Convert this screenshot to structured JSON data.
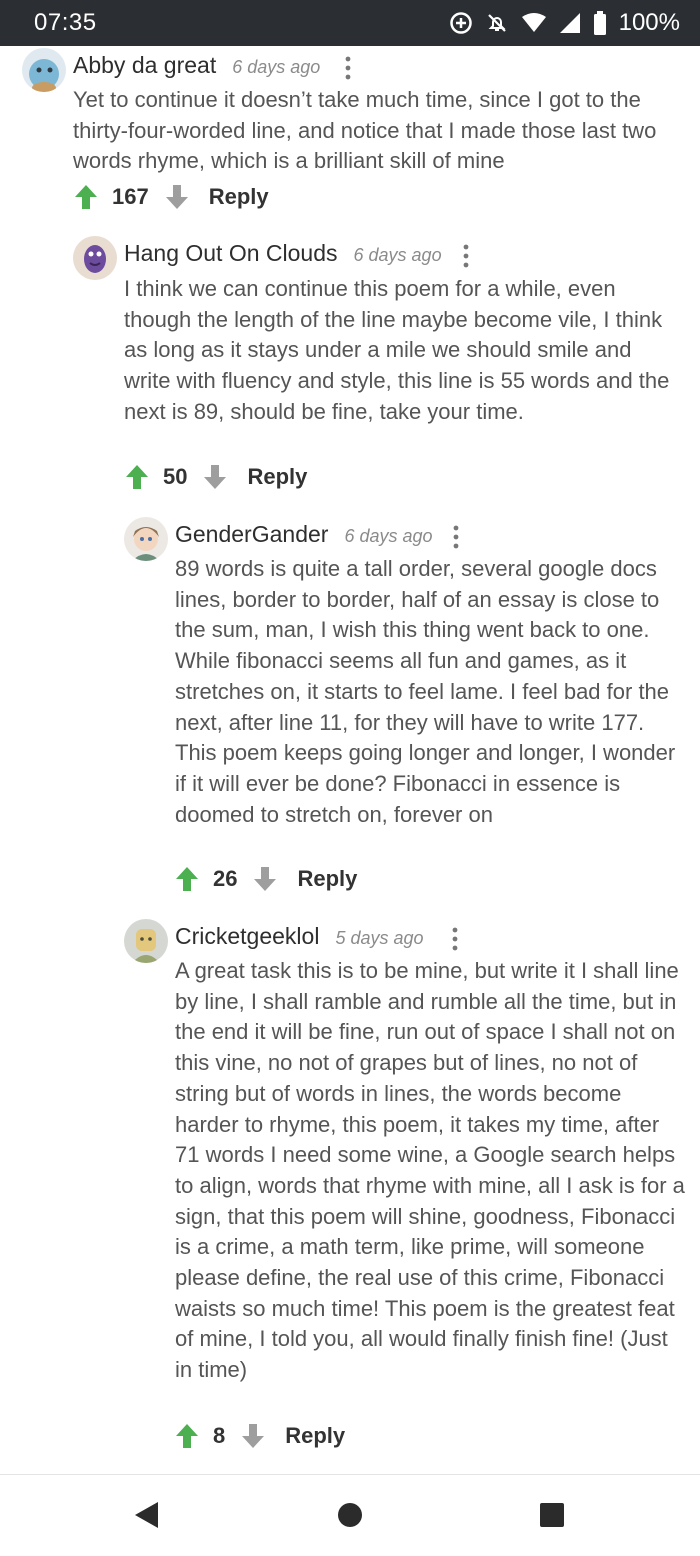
{
  "status": {
    "time": "07:35",
    "battery": "100%"
  },
  "comments": [
    {
      "author": "Abby da great",
      "time": "6 days ago",
      "body": "Yet to continue it doesn’t take much time, since I got to the thirty-four-worded line, and notice that I made those last two words rhyme, which is a brilliant skill of mine",
      "score": "167",
      "reply": "Reply"
    },
    {
      "author": "Hang Out On Clouds",
      "time": "6 days ago",
      "body": "I think we can continue this poem for a while, even though the length of the line maybe become vile, I think as long as it stays under a mile we should smile and write with fluency and style, this line is 55 words and the next is 89, should be fine, take your time.",
      "score": "50",
      "reply": "Reply"
    },
    {
      "author": "GenderGander",
      "time": "6 days ago",
      "body": "89 words is quite a tall order, several google docs lines, border to border, half of an essay is close to the sum, man, I wish this thing went back to one. While fibonacci seems all fun and games, as it stretches on, it starts to feel lame. I feel bad for the next, after line 11, for they will have to write 177. This poem keeps going longer and longer, I wonder if it will ever be done? Fibonacci in essence is doomed to stretch on, forever on",
      "score": "26",
      "reply": "Reply"
    },
    {
      "author": "Cricketgeeklol",
      "time": "5 days ago",
      "body": "A great task this is to be mine, but write it I shall line by line, I shall ramble and rumble all the time, but in the end it will be fine, run out of space I shall not on this vine, no not of grapes but of lines, no not of string but of words in lines, the words become harder to rhyme, this poem, it takes my time, after 71 words I need some wine, a Google search helps to align, words that rhyme with mine, all I ask is for a sign, that this poem will shine, goodness, Fibonacci is a crime, a math term, like prime, will someone please define, the real use of this crime, Fibonacci waists so much time! This poem is the greatest feat of mine, I told you, all would finally finish fine! (Just in time)",
      "score": "8",
      "reply": "Reply"
    }
  ],
  "colors": {
    "upvote": "#4caf50",
    "downvote": "#9e9e9e",
    "statusbar": "#2b2f33"
  },
  "icons": {
    "status": [
      "add-circle-icon",
      "notifications-off-icon",
      "wifi-icon",
      "signal-icon",
      "battery-icon"
    ],
    "comment": [
      "avatar",
      "more-vertical-icon",
      "arrow-up-icon",
      "arrow-down-icon"
    ],
    "nav": [
      "back-triangle-icon",
      "home-circle-icon",
      "recents-square-icon"
    ]
  }
}
